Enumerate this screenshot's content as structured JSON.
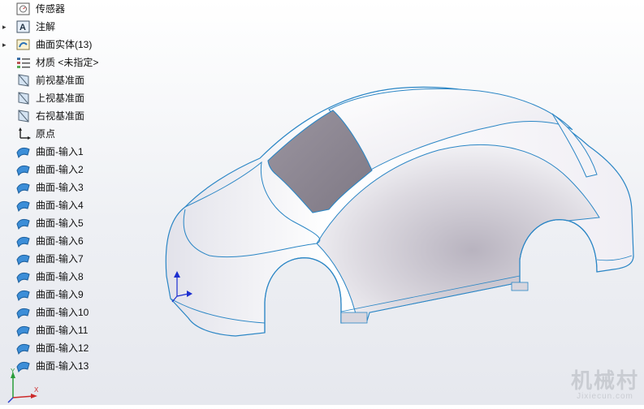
{
  "feature_tree": {
    "items": [
      {
        "label": "传感器",
        "icon": "sensor-icon",
        "expandable": false
      },
      {
        "label": "注解",
        "icon": "annotation-icon",
        "expandable": true
      },
      {
        "label": "曲面实体(13)",
        "icon": "surface-bodies-folder-icon",
        "expandable": true
      },
      {
        "label": "材质 <未指定>",
        "icon": "material-icon",
        "expandable": false
      },
      {
        "label": "前视基准面",
        "icon": "plane-icon",
        "expandable": false
      },
      {
        "label": "上视基准面",
        "icon": "plane-icon",
        "expandable": false
      },
      {
        "label": "右视基准面",
        "icon": "plane-icon",
        "expandable": false
      },
      {
        "label": "原点",
        "icon": "origin-icon",
        "expandable": false
      },
      {
        "label": "曲面-输入1",
        "icon": "surface-icon",
        "expandable": false
      },
      {
        "label": "曲面-输入2",
        "icon": "surface-icon",
        "expandable": false
      },
      {
        "label": "曲面-输入3",
        "icon": "surface-icon",
        "expandable": false
      },
      {
        "label": "曲面-输入4",
        "icon": "surface-icon",
        "expandable": false
      },
      {
        "label": "曲面-输入5",
        "icon": "surface-icon",
        "expandable": false
      },
      {
        "label": "曲面-输入6",
        "icon": "surface-icon",
        "expandable": false
      },
      {
        "label": "曲面-输入7",
        "icon": "surface-icon",
        "expandable": false
      },
      {
        "label": "曲面-输入8",
        "icon": "surface-icon",
        "expandable": false
      },
      {
        "label": "曲面-输入9",
        "icon": "surface-icon",
        "expandable": false
      },
      {
        "label": "曲面-输入10",
        "icon": "surface-icon",
        "expandable": false
      },
      {
        "label": "曲面-输入11",
        "icon": "surface-icon",
        "expandable": false
      },
      {
        "label": "曲面-输入12",
        "icon": "surface-icon",
        "expandable": false
      },
      {
        "label": "曲面-输入13",
        "icon": "surface-icon",
        "expandable": false
      }
    ]
  },
  "viewport": {
    "model": "car-body-surface-model",
    "edge_color": "#2b86c5",
    "triad": {
      "x_label": "X",
      "y_label": "Y"
    }
  },
  "watermark": {
    "main": "机械村",
    "sub": "Jixiecun.com"
  }
}
